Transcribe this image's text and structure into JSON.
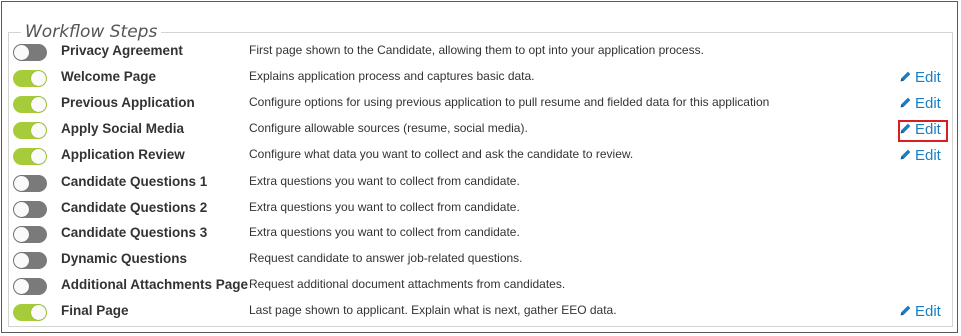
{
  "section": {
    "legend": "Workflow Steps"
  },
  "colors": {
    "toggle_on": "#a6cc3a",
    "toggle_off": "#7a7a7a",
    "edit_link": "#1a7fc1",
    "highlight": "#d81e1e"
  },
  "steps": [
    {
      "name": "Privacy Agreement",
      "description": "First page shown to the Candidate, allowing them to opt into your application process.",
      "enabled": false,
      "edit_label": ""
    },
    {
      "name": "Welcome Page",
      "description": "Explains application process and captures basic data.",
      "enabled": true,
      "edit_label": "Edit"
    },
    {
      "name": "Previous Application",
      "description": "Configure options for using previous application to pull resume and fielded data for this application",
      "enabled": true,
      "edit_label": "Edit"
    },
    {
      "name": "Apply Social Media",
      "description": "Configure allowable sources (resume, social media).",
      "enabled": true,
      "edit_label": "Edit",
      "highlighted": true
    },
    {
      "name": "Application Review",
      "description": "Configure what data you want to collect and ask the candidate to review.",
      "enabled": true,
      "edit_label": "Edit"
    },
    {
      "name": "Candidate Questions 1",
      "description": "Extra questions you want to collect from candidate.",
      "enabled": false,
      "edit_label": ""
    },
    {
      "name": "Candidate Questions 2",
      "description": "Extra questions you want to collect from candidate.",
      "enabled": false,
      "edit_label": ""
    },
    {
      "name": "Candidate Questions 3",
      "description": "Extra questions you want to collect from candidate.",
      "enabled": false,
      "edit_label": ""
    },
    {
      "name": "Dynamic Questions",
      "description": "Request candidate to answer job-related questions.",
      "enabled": false,
      "edit_label": ""
    },
    {
      "name": "Additional Attachments Page",
      "description": "Request additional document attachments from candidates.",
      "enabled": false,
      "edit_label": ""
    },
    {
      "name": "Final Page",
      "description": "Last page shown to applicant. Explain what is next, gather EEO data.",
      "enabled": true,
      "edit_label": "Edit"
    }
  ]
}
